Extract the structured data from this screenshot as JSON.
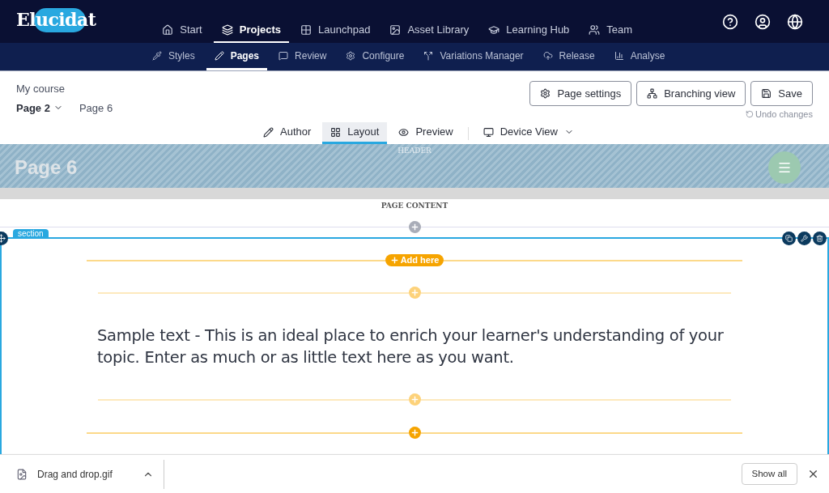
{
  "top_nav": {
    "logo": "Elucidat",
    "items": [
      {
        "label": "Start",
        "selected": false
      },
      {
        "label": "Projects",
        "selected": true
      },
      {
        "label": "Launchpad",
        "selected": false
      },
      {
        "label": "Asset Library",
        "selected": false
      },
      {
        "label": "Learning Hub",
        "selected": false
      },
      {
        "label": "Team",
        "selected": false
      }
    ]
  },
  "sub_nav": [
    {
      "label": "Styles",
      "selected": false
    },
    {
      "label": "Pages",
      "selected": true
    },
    {
      "label": "Review",
      "selected": false
    },
    {
      "label": "Configure",
      "selected": false
    },
    {
      "label": "Variations Manager",
      "selected": false
    },
    {
      "label": "Release",
      "selected": false
    },
    {
      "label": "Analyse",
      "selected": false
    }
  ],
  "breadcrumb": {
    "course": "My course",
    "page_dropdown": "Page 2",
    "page": "Page 6"
  },
  "actions": [
    {
      "label": "Page settings"
    },
    {
      "label": "Branching view"
    },
    {
      "label": "Save"
    }
  ],
  "undo": "Undo changes",
  "view_tabs": [
    {
      "label": "Author",
      "selected": false
    },
    {
      "label": "Layout",
      "selected": true
    },
    {
      "label": "Preview",
      "selected": false
    },
    {
      "label": "Device View",
      "selected": false
    }
  ],
  "header": {
    "label": "HEADER",
    "title": "Page 6"
  },
  "page_content": {
    "label": "PAGE CONTENT"
  },
  "section": {
    "label": "section",
    "items": [
      {
        "kind": "add",
        "label": "Add here",
        "faded": false
      },
      {
        "kind": "add",
        "faded": true
      },
      {
        "kind": "text",
        "text": "Sample text - This is an ideal place to enrich your learner's understanding of your topic. Enter as much or as little text here as you want."
      },
      {
        "kind": "add",
        "faded": true
      },
      {
        "kind": "add",
        "faded": false
      }
    ]
  },
  "download_bar": {
    "file": "Drag and drop.gif",
    "show_all": "Show all"
  }
}
